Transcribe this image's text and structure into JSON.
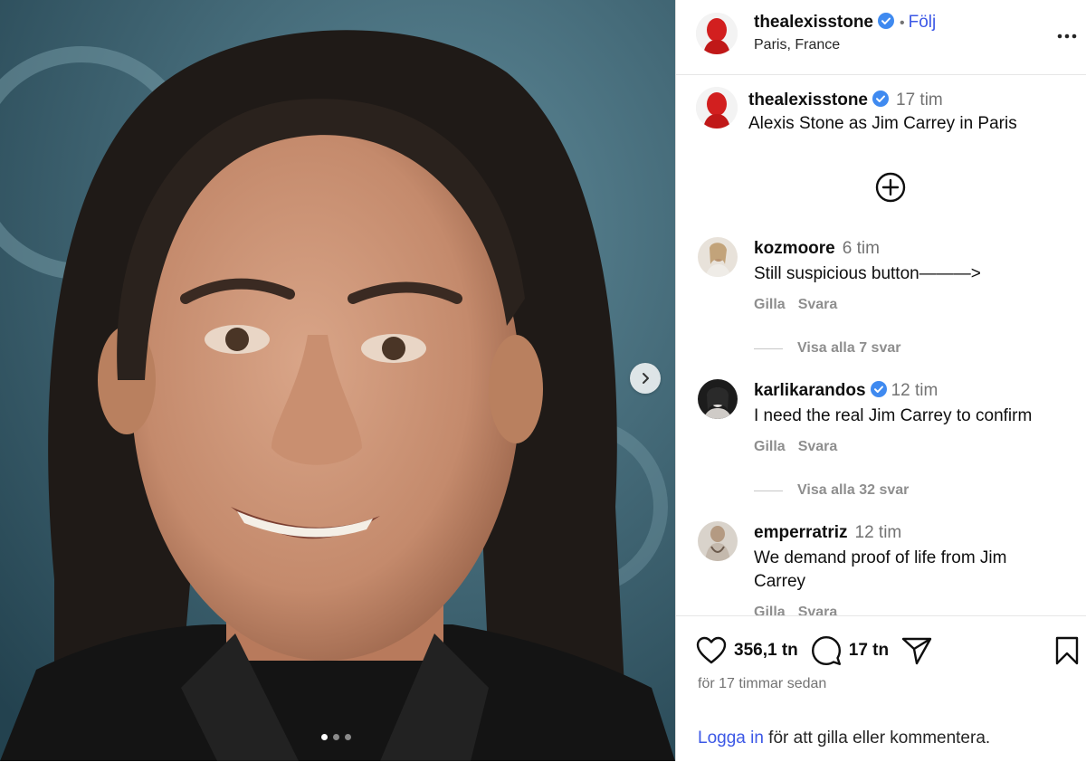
{
  "post": {
    "username": "thealexisstone",
    "follow_label": "Följ",
    "separator": "•",
    "location": "Paris, France",
    "caption_username": "thealexisstone",
    "caption_time": "17 tim",
    "caption_text": "Alexis Stone as Jim Carrey in Paris"
  },
  "comments": [
    {
      "username": "kozmoore",
      "time": "6 tim",
      "text": "Still suspicious button———>",
      "like": "Gilla",
      "reply": "Svara",
      "view_replies": "Visa alla 7 svar",
      "verified": false
    },
    {
      "username": "karlikarandos",
      "time": "12 tim",
      "text": "I need the real Jim Carrey to confirm",
      "like": "Gilla",
      "reply": "Svara",
      "view_replies": "Visa alla 32 svar",
      "verified": true
    },
    {
      "username": "emperratriz",
      "time": "12 tim",
      "text": "We demand proof of life from Jim Carrey",
      "like": "Gilla",
      "reply": "Svara",
      "verified": false
    }
  ],
  "stats": {
    "likes": "356,1 tn",
    "comments": "17 tn"
  },
  "posted_time": "för 17 timmar sedan",
  "login": {
    "link": "Logga in",
    "rest": " för att gilla eller kommentera."
  },
  "carousel": {
    "count": 3,
    "active": 1
  },
  "colors": {
    "accent": "#3c58e6",
    "verified": "#3f8af0",
    "muted": "#737373"
  }
}
